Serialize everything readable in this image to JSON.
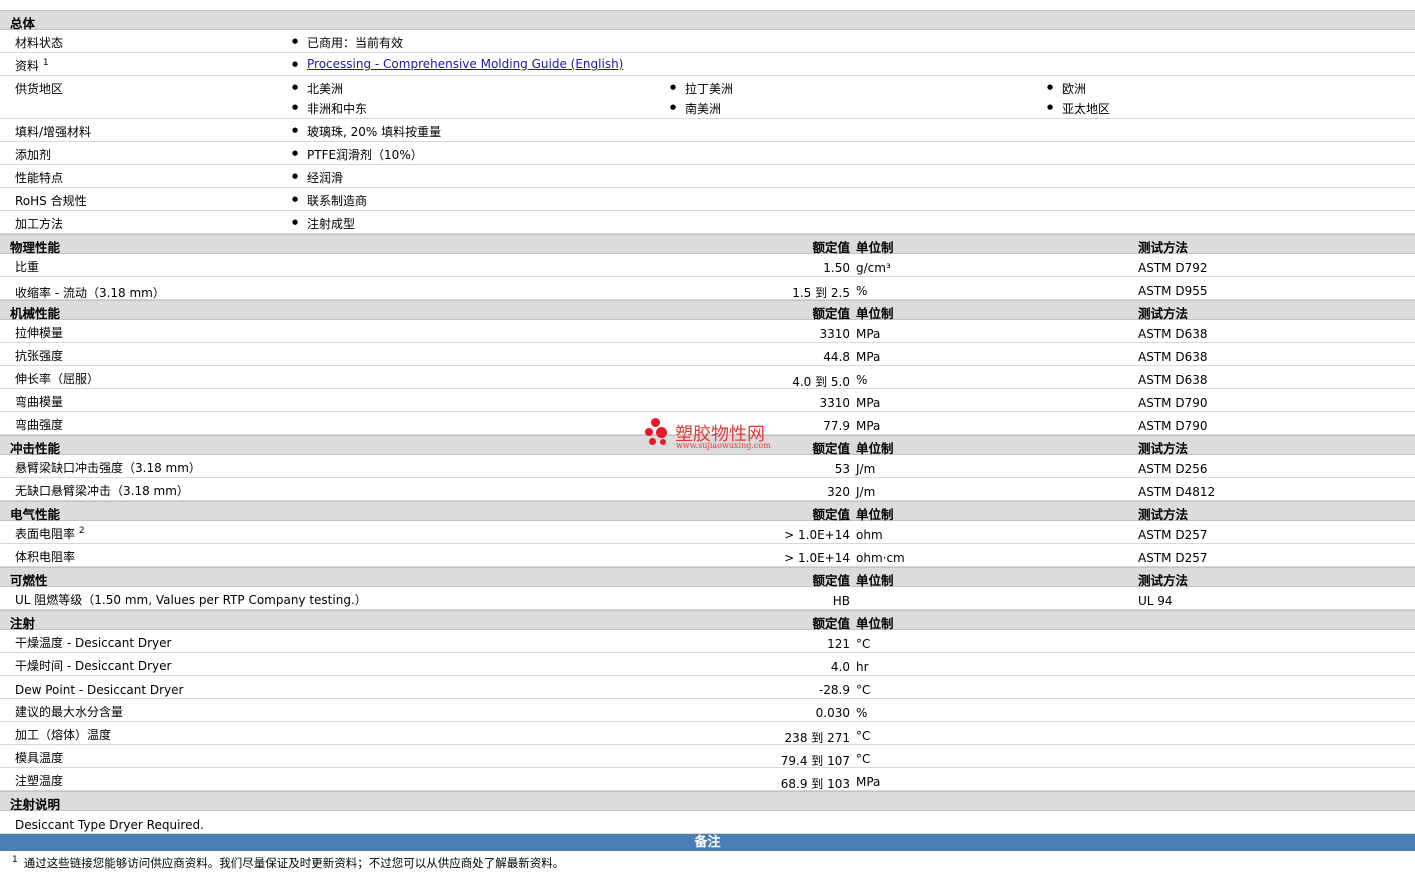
{
  "general": {
    "title": "总体",
    "status_label": "材料状态",
    "status_value": "已商用：当前有效",
    "docs_label": "资料",
    "docs_sup": "1",
    "docs_link": "Processing - Comprehensive Molding Guide (English)",
    "regions_label": "供货地区",
    "regions": [
      "北美洲",
      "拉丁美洲",
      "欧洲",
      "非洲和中东",
      "南美洲",
      "亚太地区"
    ],
    "filler_label": "填料/增强材料",
    "filler_value": "玻璃珠, 20% 填料按重量",
    "additive_label": "添加剂",
    "additive_value": "PTFE润滑剂（10%）",
    "features_label": "性能特点",
    "features_value": "经润滑",
    "rohs_label": "RoHS 合规性",
    "rohs_value": "联系制造商",
    "process_label": "加工方法",
    "process_value": "注射成型"
  },
  "headers": {
    "value": "额定值",
    "unit": "单位制",
    "method": "测试方法"
  },
  "physical": {
    "title": "物理性能",
    "rows": [
      {
        "label": "比重",
        "value": "1.50",
        "unit": "g/cm³",
        "method": "ASTM D792"
      },
      {
        "label": "收缩率  - 流动（3.18 mm）",
        "value": "1.5 到  2.5",
        "unit": "%",
        "method": "ASTM D955"
      }
    ]
  },
  "mechanical": {
    "title": "机械性能",
    "rows": [
      {
        "label": "拉伸模量",
        "value": "3310",
        "unit": "MPa",
        "method": "ASTM D638"
      },
      {
        "label": "抗张强度",
        "value": "44.8",
        "unit": "MPa",
        "method": "ASTM D638"
      },
      {
        "label": "伸长率（屈服）",
        "value": "4.0 到  5.0",
        "unit": "%",
        "method": "ASTM D638"
      },
      {
        "label": "弯曲模量",
        "value": "3310",
        "unit": "MPa",
        "method": "ASTM D790"
      },
      {
        "label": "弯曲强度",
        "value": "77.9",
        "unit": "MPa",
        "method": "ASTM D790"
      }
    ]
  },
  "impact": {
    "title": "冲击性能",
    "rows": [
      {
        "label": "悬臂梁缺口冲击强度（3.18 mm）",
        "value": "53",
        "unit": "J/m",
        "method": "ASTM D256"
      },
      {
        "label": "无缺口悬臂梁冲击（3.18 mm）",
        "value": "320",
        "unit": "J/m",
        "method": "ASTM D4812"
      }
    ]
  },
  "electrical": {
    "title": "电气性能",
    "rows": [
      {
        "label": "表面电阻率",
        "sup": "2",
        "value": "> 1.0E+14",
        "unit": "ohm",
        "method": "ASTM D257"
      },
      {
        "label": "体积电阻率",
        "value": "> 1.0E+14",
        "unit": "ohm·cm",
        "method": "ASTM D257"
      }
    ]
  },
  "flammability": {
    "title": "可燃性",
    "rows": [
      {
        "label": "UL 阻燃等级（1.50 mm, Values per RTP Company testing.）",
        "value": "HB",
        "unit": "",
        "method": "UL 94"
      }
    ]
  },
  "injection": {
    "title": "注射",
    "rows": [
      {
        "label": "干燥温度  - Desiccant Dryer",
        "value": "121",
        "unit": "°C"
      },
      {
        "label": "干燥时间  - Desiccant Dryer",
        "value": "4.0",
        "unit": "hr"
      },
      {
        "label": "Dew Point - Desiccant Dryer",
        "value": "-28.9",
        "unit": "°C"
      },
      {
        "label": "建议的最大水分含量",
        "value": "0.030",
        "unit": "%"
      },
      {
        "label": "加工（熔体）温度",
        "value": "238 到  271",
        "unit": "°C"
      },
      {
        "label": "模具温度",
        "value": "79.4 到  107",
        "unit": "°C"
      },
      {
        "label": "注塑温度",
        "value": "68.9 到  103",
        "unit": "MPa"
      }
    ]
  },
  "injection_notes": {
    "title": "注射说明",
    "text": "Desiccant Type Dryer Required."
  },
  "remarks": {
    "title": "备注",
    "footnote_num": "1",
    "footnote_text": "通过这些链接您能够访问供应商资料。我们尽量保证及时更新资料；不过您可以从供应商处了解最新资料。"
  },
  "watermark": {
    "name": "塑胶物性网",
    "url": "www.sujiaowuxing.com",
    "color": "#e8182a"
  }
}
